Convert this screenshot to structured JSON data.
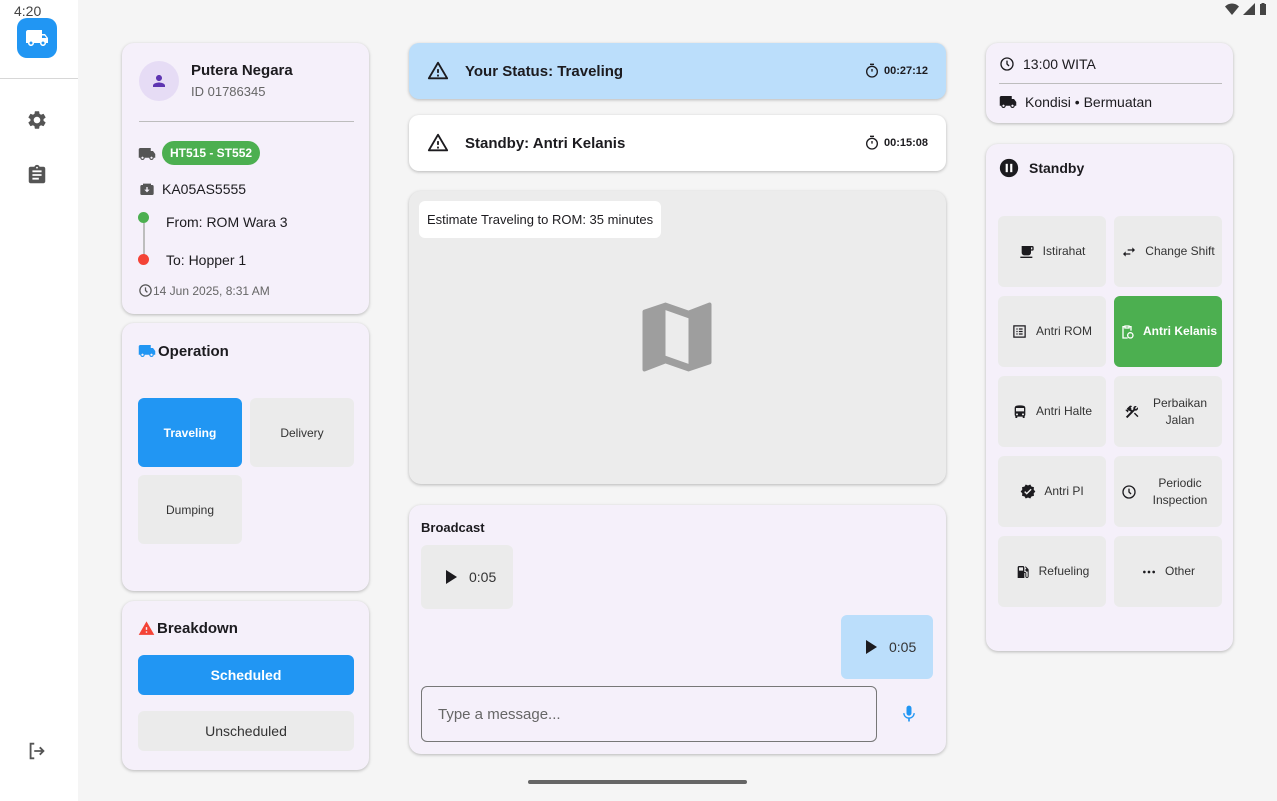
{
  "system": {
    "time": "4:20"
  },
  "profile": {
    "name": "Putera Negara",
    "id": "ID 01786345",
    "unit_badge": "HT515 - ST552",
    "plate": "KA05AS5555",
    "from": "From: ROM Wara 3",
    "to": "To: Hopper 1",
    "timestamp": "14 Jun 2025, 8:31 AM"
  },
  "operation": {
    "title": "Operation",
    "buttons": [
      {
        "label": "Traveling",
        "active": true
      },
      {
        "label": "Delivery",
        "active": false
      },
      {
        "label": "Dumping",
        "active": false
      }
    ]
  },
  "breakdown": {
    "title": "Breakdown",
    "scheduled": "Scheduled",
    "unscheduled": "Unscheduled"
  },
  "status": {
    "current": {
      "label": "Your Status: Traveling",
      "timer": "00:27:12",
      "color": "#bbdefb"
    },
    "standby": {
      "label": "Standby: Antri Kelanis",
      "timer": "00:15:08",
      "color": "#ffffff"
    }
  },
  "map": {
    "estimate": "Estimate Traveling to ROM: 35 minutes"
  },
  "broadcast": {
    "title": "Broadcast",
    "messages": [
      {
        "duration": "0:05",
        "side": "left"
      },
      {
        "duration": "0:05",
        "side": "right"
      }
    ],
    "input_placeholder": "Type a message..."
  },
  "info": {
    "time": "13:00 WITA",
    "condition": "Kondisi • Bermuatan"
  },
  "standby_panel": {
    "title": "Standby",
    "buttons": [
      {
        "label": "Istirahat",
        "icon": "coffee-icon",
        "active": false
      },
      {
        "label": "Change Shift",
        "icon": "swap-icon",
        "active": false
      },
      {
        "label": "Antri ROM",
        "icon": "list-icon",
        "active": false
      },
      {
        "label": "Antri Kelanis",
        "icon": "clipboard-clock-icon",
        "active": true
      },
      {
        "label": "Antri Halte",
        "icon": "bus-icon",
        "active": false
      },
      {
        "label": "Perbaikan Jalan",
        "icon": "tools-icon",
        "active": false
      },
      {
        "label": "Antri PI",
        "icon": "verified-icon",
        "active": false
      },
      {
        "label": "Periodic Inspection",
        "icon": "clock-icon",
        "active": false
      },
      {
        "label": "Refueling",
        "icon": "fuel-icon",
        "active": false
      },
      {
        "label": "Other",
        "icon": "more-icon",
        "active": false
      }
    ]
  },
  "colors": {
    "primary": "#2196f3",
    "success": "#4caf50",
    "danger": "#f44336",
    "card": "#f5f0fa"
  }
}
